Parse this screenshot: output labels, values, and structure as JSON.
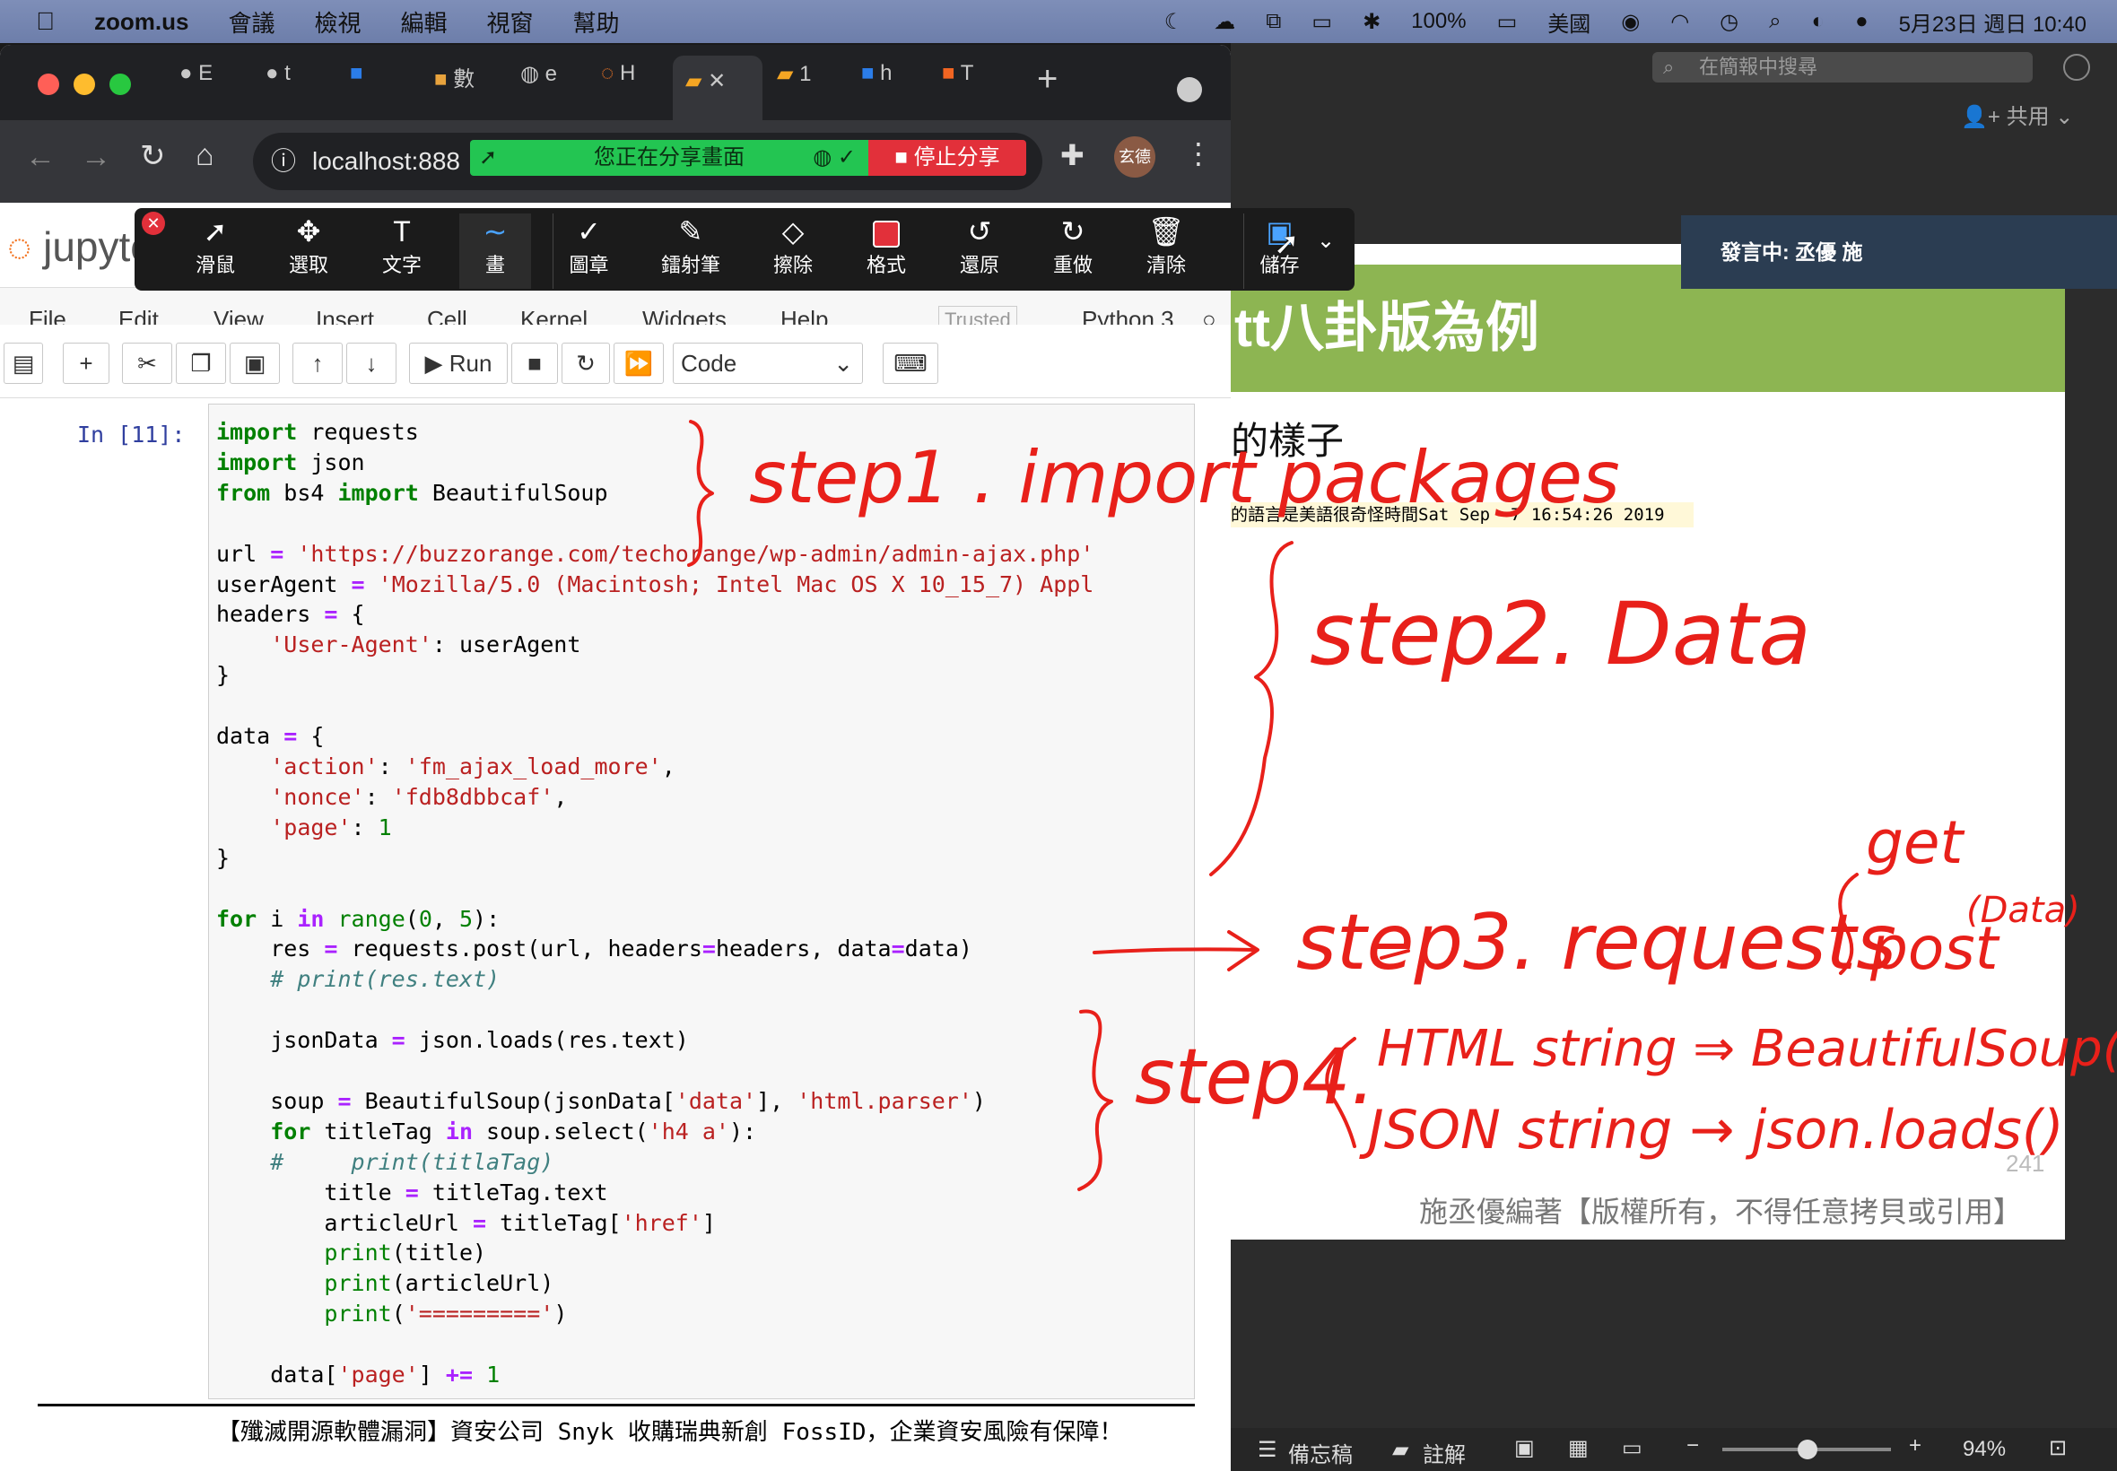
{
  "menubar": {
    "apple": "",
    "app": "zoom.us",
    "items": [
      "會議",
      "檢視",
      "編輯",
      "視窗",
      "幫助"
    ],
    "battery": "100%",
    "input_source": "美國",
    "clock": "5月23日 週日 10:40"
  },
  "zoom": {
    "search_placeholder": "在簡報中搜尋",
    "share_label": "共用",
    "speaker": "發言中: 丞優 施",
    "share_banner": "您正在分享畫面",
    "stop_share": "停止分享",
    "status": {
      "notes": "備忘稿",
      "comments": "註解",
      "zoom": "94%"
    }
  },
  "annotate_toolbar": [
    {
      "icon": "pointer",
      "label": "滑鼠"
    },
    {
      "icon": "move",
      "label": "選取"
    },
    {
      "icon": "text",
      "label": "文字"
    },
    {
      "icon": "draw",
      "label": "畫"
    },
    {
      "icon": "stamp",
      "label": "圖章"
    },
    {
      "icon": "spotlight",
      "label": "鐳射筆"
    },
    {
      "icon": "eraser",
      "label": "擦除"
    },
    {
      "icon": "format",
      "label": "格式"
    },
    {
      "icon": "undo",
      "label": "還原"
    },
    {
      "icon": "redo",
      "label": "重做"
    },
    {
      "icon": "clear",
      "label": "清除"
    },
    {
      "icon": "save",
      "label": "儲存"
    }
  ],
  "slide": {
    "title": "tt八卦版為例",
    "heading": "的樣子",
    "sample": "的語言是美語很奇怪時間Sat Sep  7 16:54:26 2019",
    "page": "241",
    "footer": "施丞優編著【版權所有，不得任意拷貝或引用】"
  },
  "browser": {
    "tabs": [
      "E",
      "t",
      "",
      "數",
      "e",
      "H",
      "",
      "1",
      "h",
      "T"
    ],
    "url": "localhost:888",
    "avatar": "玄德"
  },
  "jupyter": {
    "logo": "jupyter",
    "menu": [
      "File",
      "Edit",
      "View",
      "Insert",
      "Cell",
      "Kernel",
      "Widgets",
      "Help"
    ],
    "trusted": "Trusted",
    "kernel": "Python 3",
    "run": "Run",
    "cell_type": "Code",
    "prompt": "In [11]:",
    "output": "【殲滅開源軟體漏洞】資安公司 Snyk 收購瑞典新創 FossID，企業資安風險有保障！"
  },
  "annotations": {
    "step1": "step1 . import packages",
    "step2": "step2. Data",
    "step3": "step3. requests",
    "step3_get": "get",
    "step3_post": "post",
    "step3_data": "(Data)",
    "step4": "step4.",
    "step4_html": "HTML string ⇒ BeautifulSoup()",
    "step4_json": "JSON string → json.loads()"
  }
}
